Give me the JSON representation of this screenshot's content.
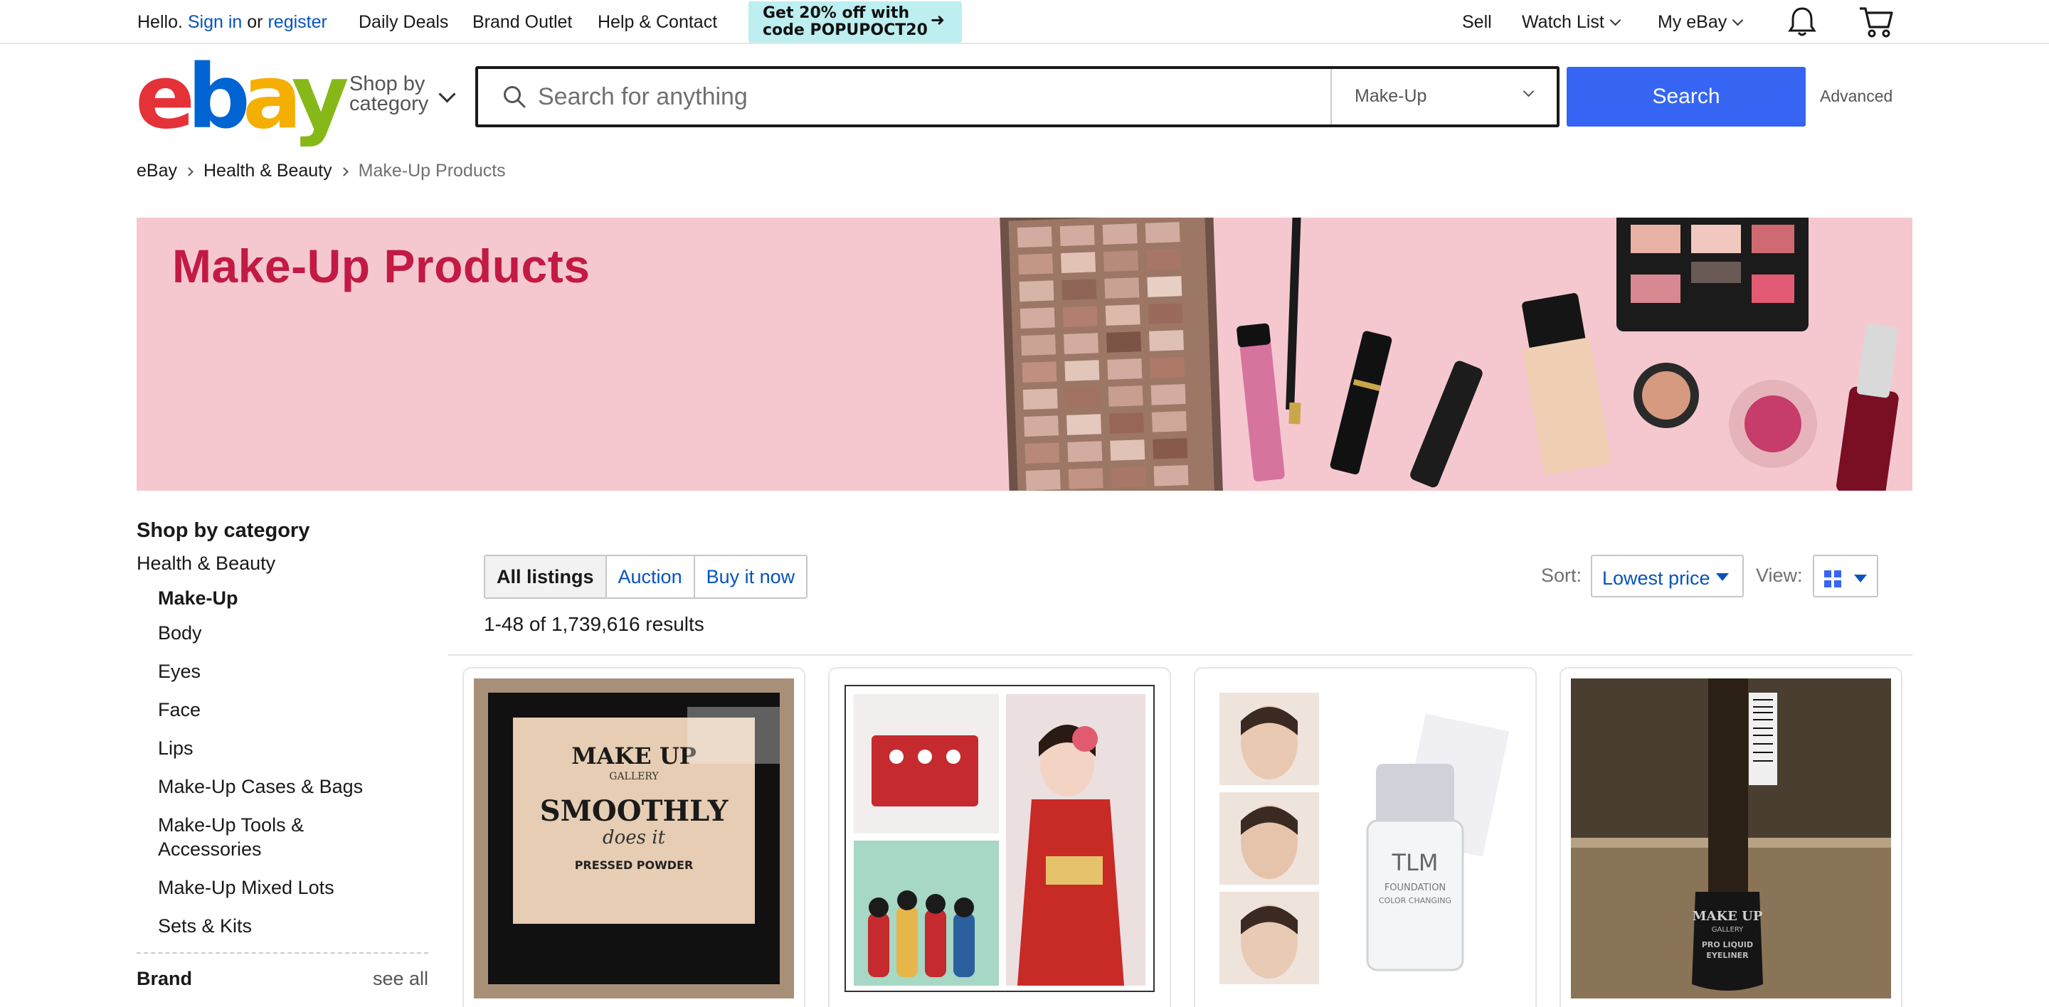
{
  "topbar": {
    "hello": "Hello.",
    "sign_in": "Sign in",
    "or": "or",
    "register": "register",
    "daily_deals": "Daily Deals",
    "brand_outlet": "Brand Outlet",
    "help_contact": "Help & Contact",
    "promo_line1": "Get 20% off with",
    "promo_line2": "code POPUPOCT20",
    "sell": "Sell",
    "watch_list": "Watch List",
    "my_ebay": "My eBay"
  },
  "header": {
    "shop_by_line1": "Shop by",
    "shop_by_line2": "category",
    "search_placeholder": "Search for anything",
    "category_selected": "Make-Up",
    "search_button": "Search",
    "advanced": "Advanced"
  },
  "breadcrumb": {
    "items": [
      "eBay",
      "Health & Beauty"
    ],
    "current": "Make-Up Products"
  },
  "banner": {
    "title": "Make-Up Products"
  },
  "sidebar": {
    "heading": "Shop by category",
    "parent": "Health & Beauty",
    "current": "Make-Up",
    "children": [
      "Body",
      "Eyes",
      "Face",
      "Lips",
      "Make-Up Cases & Bags",
      "Make-Up Tools & Accessories",
      "Make-Up Mixed Lots",
      "Sets & Kits"
    ],
    "brand_heading": "Brand",
    "see_all": "see all"
  },
  "results": {
    "tabs": [
      "All listings",
      "Auction",
      "Buy it now"
    ],
    "active_tab": "All listings",
    "count": "1-48 of 1,739,616 results",
    "sort_label": "Sort:",
    "sort_value": "Lowest price",
    "view_label": "View:"
  },
  "products": [
    {
      "image_text": [
        "MAKE UP",
        "GALLERY",
        "SMOOTHLY",
        "does it",
        "PRESSED POWDER"
      ]
    },
    {
      "image_text": []
    },
    {
      "image_text": [
        "TLM",
        "FOUNDATION",
        "COLOR CHANGING"
      ]
    },
    {
      "image_text": [
        "MAKE UP",
        "GALLERY",
        "PRO LIQUID",
        "EYELINER"
      ]
    }
  ],
  "colors": {
    "brand_blue": "#3665f3",
    "link": "#0654ba",
    "banner_bg": "#f5c8d0",
    "banner_title": "#c21a44"
  }
}
